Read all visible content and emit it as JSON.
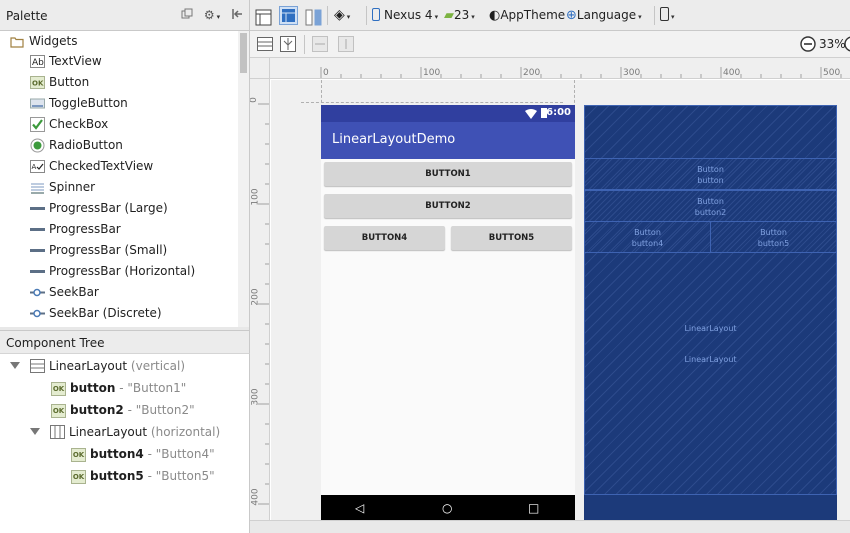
{
  "palette": {
    "title": "Palette",
    "items": [
      {
        "label": "Widgets",
        "icon": "folder-icon"
      },
      {
        "label": "TextView",
        "icon": "textview-icon",
        "glyph": "Ab"
      },
      {
        "label": "Button",
        "icon": "button-icon",
        "glyph": "OK"
      },
      {
        "label": "ToggleButton",
        "icon": "togglebutton-icon"
      },
      {
        "label": "CheckBox",
        "icon": "checkbox-icon"
      },
      {
        "label": "RadioButton",
        "icon": "radiobutton-icon"
      },
      {
        "label": "CheckedTextView",
        "icon": "checkedtextview-icon"
      },
      {
        "label": "Spinner",
        "icon": "spinner-icon"
      },
      {
        "label": "ProgressBar (Large)",
        "icon": "progressbar-icon"
      },
      {
        "label": "ProgressBar",
        "icon": "progressbar-icon"
      },
      {
        "label": "ProgressBar (Small)",
        "icon": "progressbar-icon"
      },
      {
        "label": "ProgressBar (Horizontal)",
        "icon": "progressbar-icon"
      },
      {
        "label": "SeekBar",
        "icon": "seekbar-icon"
      },
      {
        "label": "SeekBar (Discrete)",
        "icon": "seekbar-icon"
      }
    ]
  },
  "component_tree": {
    "title": "Component Tree",
    "nodes": [
      {
        "name": "LinearLayout",
        "detail": "(vertical)"
      },
      {
        "name": "button",
        "detail": "- \"Button1\""
      },
      {
        "name": "button2",
        "detail": "- \"Button2\""
      },
      {
        "name": "LinearLayout",
        "detail": "(horizontal)"
      },
      {
        "name": "button4",
        "detail": "- \"Button4\""
      },
      {
        "name": "button5",
        "detail": "- \"Button5\""
      }
    ]
  },
  "toolbar": {
    "device": "Nexus 4",
    "api": "23",
    "theme": "AppTheme",
    "language": "Language",
    "zoom": "33%"
  },
  "rulers": {
    "horizontal": [
      "0",
      "100",
      "200",
      "300",
      "400",
      "500"
    ],
    "vertical": [
      "0",
      "100",
      "200",
      "300",
      "400"
    ]
  },
  "preview": {
    "status_time": "6:00",
    "app_title": "LinearLayoutDemo",
    "buttons": [
      "BUTTON1",
      "BUTTON2",
      "BUTTON4",
      "BUTTON5"
    ]
  },
  "blueprint": {
    "button1": [
      "Button",
      "button"
    ],
    "button2": [
      "Button",
      "button2"
    ],
    "button4": [
      "Button",
      "button4"
    ],
    "button5": [
      "Button",
      "button5"
    ],
    "layout_labels": [
      "LinearLayout",
      "LinearLayout"
    ]
  },
  "colors": {
    "primary": "#3f51b5",
    "primary_dark": "#303f9f",
    "blueprint_bg": "#1c3a7a",
    "blueprint_line": "#3e63b2"
  }
}
